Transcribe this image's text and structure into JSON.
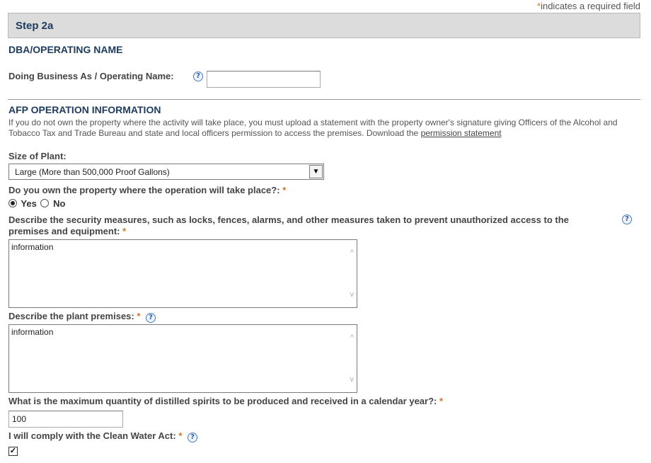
{
  "required_note": {
    "star": "*",
    "text": "indicates a required field"
  },
  "step": {
    "title": "Step 2a"
  },
  "dba": {
    "section_title": "DBA/OPERATING NAME",
    "label": "Doing Business As / Operating Name:",
    "value": ""
  },
  "afp": {
    "section_title": "AFP OPERATION INFORMATION",
    "info_text": "If you do not own the property where the activity will take place, you must upload a statement with the property owner's signature giving Officers of the Alcohol and Tobacco Tax and Trade Bureau and state and local officers permission to access the premises. Download the",
    "info_link": "permission statement",
    "size_label": "Size of Plant:",
    "size_value": "Large (More than 500,000 Proof Gallons)",
    "own_label": "Do you own the property where the operation will take place?:",
    "own_yes": "Yes",
    "own_no": "No",
    "own_selected": "Yes",
    "security_label_line1": "Describe the security measures, such as locks, fences, alarms, and other measures taken to prevent unauthorized access to the",
    "security_label_line2": "premises and equipment:",
    "security_value": "information",
    "premises_label": "Describe the plant premises:",
    "premises_value": "information",
    "quantity_label": "What is the maximum quantity of distilled spirits to be produced and received in a calendar year?:",
    "quantity_value": "100",
    "clean_water_label": "I will comply with the Clean Water Act:",
    "clean_water_checked": true
  },
  "icons": {
    "help": "help-icon",
    "check": "✓",
    "help_glyph": "?",
    "scroll_up": "^",
    "scroll_down": "v",
    "dropdown": "▼"
  },
  "colors": {
    "section_title": "#1c3b5e",
    "required_star": "#cc7722",
    "header_bg": "#dcdcdc"
  }
}
